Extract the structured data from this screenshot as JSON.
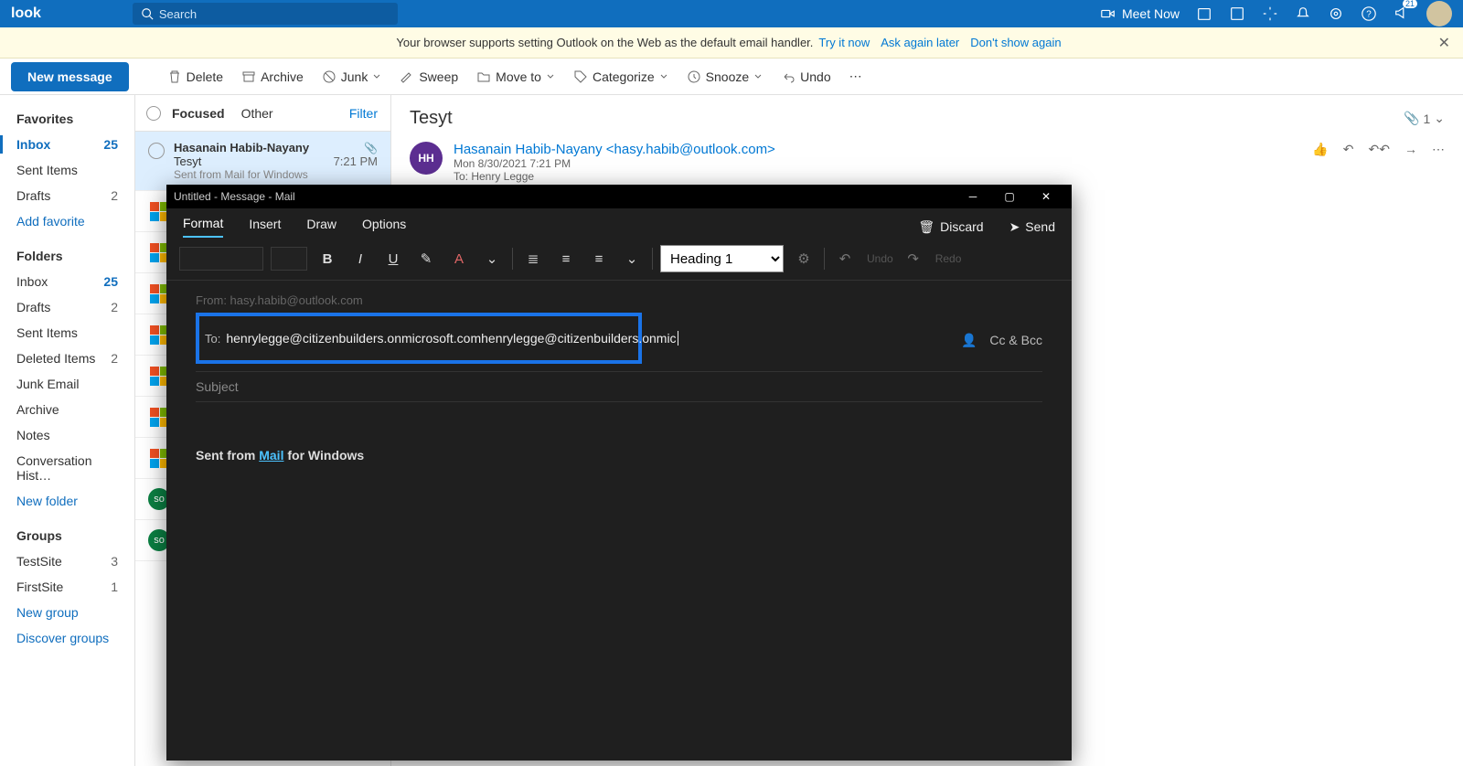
{
  "header": {
    "app_name": "look",
    "search_placeholder": "Search",
    "meet_now": "Meet Now",
    "notif_count": "21"
  },
  "banner": {
    "text": "Your browser supports setting Outlook on the Web as the default email handler.",
    "try": "Try it now",
    "ask": "Ask again later",
    "dont": "Don't show again"
  },
  "commands": {
    "new_message": "New message",
    "delete": "Delete",
    "archive": "Archive",
    "junk": "Junk",
    "sweep": "Sweep",
    "move_to": "Move to",
    "categorize": "Categorize",
    "snooze": "Snooze",
    "undo": "Undo"
  },
  "nav": {
    "favorites": "Favorites",
    "inbox": "Inbox",
    "inbox_count": "25",
    "sent": "Sent Items",
    "drafts": "Drafts",
    "drafts_count": "2",
    "add_fav": "Add favorite",
    "folders": "Folders",
    "deleted": "Deleted Items",
    "deleted_count": "2",
    "junk": "Junk Email",
    "archive": "Archive",
    "notes": "Notes",
    "conv": "Conversation Hist…",
    "new_folder": "New folder",
    "groups": "Groups",
    "testsite": "TestSite",
    "testsite_count": "3",
    "firstsite": "FirstSite",
    "firstsite_count": "1",
    "new_group": "New group",
    "discover": "Discover groups"
  },
  "list": {
    "focused": "Focused",
    "other": "Other",
    "filter": "Filter",
    "item": {
      "from": "Hasanain Habib-Nayany",
      "subject": "Tesyt",
      "time": "7:21 PM",
      "preview": "Sent from Mail for Windows"
    }
  },
  "reading": {
    "subject": "Tesyt",
    "attach_count": "1",
    "avatar": "HH",
    "from": "Hasanain Habib-Nayany <hasy.habib@outlook.com>",
    "date": "Mon 8/30/2021 7:21 PM",
    "to": "To:  Henry Legge"
  },
  "modal": {
    "title": "Untitled - Message - Mail",
    "tabs": {
      "format": "Format",
      "insert": "Insert",
      "draw": "Draw",
      "options": "Options"
    },
    "discard": "Discard",
    "send": "Send",
    "heading": "Heading 1",
    "undo": "Undo",
    "redo": "Redo",
    "from": "From: hasy.habib@outlook.com",
    "to_label": "To:",
    "to_value": "henrylegge@citizenbuilders.onmicrosoft.comhenrylegge@citizenbuilders.onmic",
    "cc_bcc": "Cc & Bcc",
    "subject_ph": "Subject",
    "sig_pre": "Sent from ",
    "sig_link": "Mail",
    "sig_post": " for Windows"
  }
}
